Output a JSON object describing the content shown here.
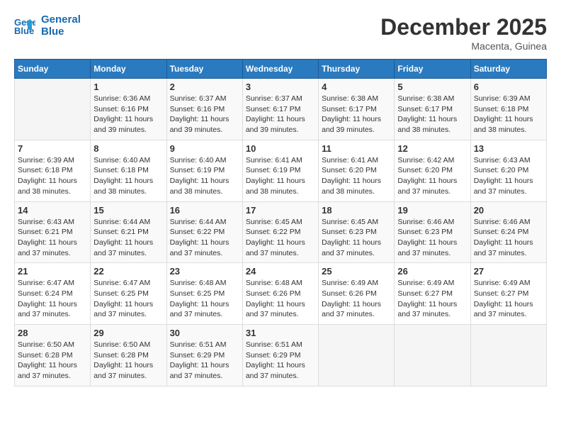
{
  "header": {
    "logo_line1": "General",
    "logo_line2": "Blue",
    "month": "December 2025",
    "location": "Macenta, Guinea"
  },
  "weekdays": [
    "Sunday",
    "Monday",
    "Tuesday",
    "Wednesday",
    "Thursday",
    "Friday",
    "Saturday"
  ],
  "weeks": [
    [
      {
        "day": "",
        "sunrise": "",
        "sunset": "",
        "daylight": ""
      },
      {
        "day": "1",
        "sunrise": "Sunrise: 6:36 AM",
        "sunset": "Sunset: 6:16 PM",
        "daylight": "Daylight: 11 hours and 39 minutes."
      },
      {
        "day": "2",
        "sunrise": "Sunrise: 6:37 AM",
        "sunset": "Sunset: 6:16 PM",
        "daylight": "Daylight: 11 hours and 39 minutes."
      },
      {
        "day": "3",
        "sunrise": "Sunrise: 6:37 AM",
        "sunset": "Sunset: 6:17 PM",
        "daylight": "Daylight: 11 hours and 39 minutes."
      },
      {
        "day": "4",
        "sunrise": "Sunrise: 6:38 AM",
        "sunset": "Sunset: 6:17 PM",
        "daylight": "Daylight: 11 hours and 39 minutes."
      },
      {
        "day": "5",
        "sunrise": "Sunrise: 6:38 AM",
        "sunset": "Sunset: 6:17 PM",
        "daylight": "Daylight: 11 hours and 38 minutes."
      },
      {
        "day": "6",
        "sunrise": "Sunrise: 6:39 AM",
        "sunset": "Sunset: 6:18 PM",
        "daylight": "Daylight: 11 hours and 38 minutes."
      }
    ],
    [
      {
        "day": "7",
        "sunrise": "Sunrise: 6:39 AM",
        "sunset": "Sunset: 6:18 PM",
        "daylight": "Daylight: 11 hours and 38 minutes."
      },
      {
        "day": "8",
        "sunrise": "Sunrise: 6:40 AM",
        "sunset": "Sunset: 6:18 PM",
        "daylight": "Daylight: 11 hours and 38 minutes."
      },
      {
        "day": "9",
        "sunrise": "Sunrise: 6:40 AM",
        "sunset": "Sunset: 6:19 PM",
        "daylight": "Daylight: 11 hours and 38 minutes."
      },
      {
        "day": "10",
        "sunrise": "Sunrise: 6:41 AM",
        "sunset": "Sunset: 6:19 PM",
        "daylight": "Daylight: 11 hours and 38 minutes."
      },
      {
        "day": "11",
        "sunrise": "Sunrise: 6:41 AM",
        "sunset": "Sunset: 6:20 PM",
        "daylight": "Daylight: 11 hours and 38 minutes."
      },
      {
        "day": "12",
        "sunrise": "Sunrise: 6:42 AM",
        "sunset": "Sunset: 6:20 PM",
        "daylight": "Daylight: 11 hours and 37 minutes."
      },
      {
        "day": "13",
        "sunrise": "Sunrise: 6:43 AM",
        "sunset": "Sunset: 6:20 PM",
        "daylight": "Daylight: 11 hours and 37 minutes."
      }
    ],
    [
      {
        "day": "14",
        "sunrise": "Sunrise: 6:43 AM",
        "sunset": "Sunset: 6:21 PM",
        "daylight": "Daylight: 11 hours and 37 minutes."
      },
      {
        "day": "15",
        "sunrise": "Sunrise: 6:44 AM",
        "sunset": "Sunset: 6:21 PM",
        "daylight": "Daylight: 11 hours and 37 minutes."
      },
      {
        "day": "16",
        "sunrise": "Sunrise: 6:44 AM",
        "sunset": "Sunset: 6:22 PM",
        "daylight": "Daylight: 11 hours and 37 minutes."
      },
      {
        "day": "17",
        "sunrise": "Sunrise: 6:45 AM",
        "sunset": "Sunset: 6:22 PM",
        "daylight": "Daylight: 11 hours and 37 minutes."
      },
      {
        "day": "18",
        "sunrise": "Sunrise: 6:45 AM",
        "sunset": "Sunset: 6:23 PM",
        "daylight": "Daylight: 11 hours and 37 minutes."
      },
      {
        "day": "19",
        "sunrise": "Sunrise: 6:46 AM",
        "sunset": "Sunset: 6:23 PM",
        "daylight": "Daylight: 11 hours and 37 minutes."
      },
      {
        "day": "20",
        "sunrise": "Sunrise: 6:46 AM",
        "sunset": "Sunset: 6:24 PM",
        "daylight": "Daylight: 11 hours and 37 minutes."
      }
    ],
    [
      {
        "day": "21",
        "sunrise": "Sunrise: 6:47 AM",
        "sunset": "Sunset: 6:24 PM",
        "daylight": "Daylight: 11 hours and 37 minutes."
      },
      {
        "day": "22",
        "sunrise": "Sunrise: 6:47 AM",
        "sunset": "Sunset: 6:25 PM",
        "daylight": "Daylight: 11 hours and 37 minutes."
      },
      {
        "day": "23",
        "sunrise": "Sunrise: 6:48 AM",
        "sunset": "Sunset: 6:25 PM",
        "daylight": "Daylight: 11 hours and 37 minutes."
      },
      {
        "day": "24",
        "sunrise": "Sunrise: 6:48 AM",
        "sunset": "Sunset: 6:26 PM",
        "daylight": "Daylight: 11 hours and 37 minutes."
      },
      {
        "day": "25",
        "sunrise": "Sunrise: 6:49 AM",
        "sunset": "Sunset: 6:26 PM",
        "daylight": "Daylight: 11 hours and 37 minutes."
      },
      {
        "day": "26",
        "sunrise": "Sunrise: 6:49 AM",
        "sunset": "Sunset: 6:27 PM",
        "daylight": "Daylight: 11 hours and 37 minutes."
      },
      {
        "day": "27",
        "sunrise": "Sunrise: 6:49 AM",
        "sunset": "Sunset: 6:27 PM",
        "daylight": "Daylight: 11 hours and 37 minutes."
      }
    ],
    [
      {
        "day": "28",
        "sunrise": "Sunrise: 6:50 AM",
        "sunset": "Sunset: 6:28 PM",
        "daylight": "Daylight: 11 hours and 37 minutes."
      },
      {
        "day": "29",
        "sunrise": "Sunrise: 6:50 AM",
        "sunset": "Sunset: 6:28 PM",
        "daylight": "Daylight: 11 hours and 37 minutes."
      },
      {
        "day": "30",
        "sunrise": "Sunrise: 6:51 AM",
        "sunset": "Sunset: 6:29 PM",
        "daylight": "Daylight: 11 hours and 37 minutes."
      },
      {
        "day": "31",
        "sunrise": "Sunrise: 6:51 AM",
        "sunset": "Sunset: 6:29 PM",
        "daylight": "Daylight: 11 hours and 37 minutes."
      },
      {
        "day": "",
        "sunrise": "",
        "sunset": "",
        "daylight": ""
      },
      {
        "day": "",
        "sunrise": "",
        "sunset": "",
        "daylight": ""
      },
      {
        "day": "",
        "sunrise": "",
        "sunset": "",
        "daylight": ""
      }
    ]
  ]
}
